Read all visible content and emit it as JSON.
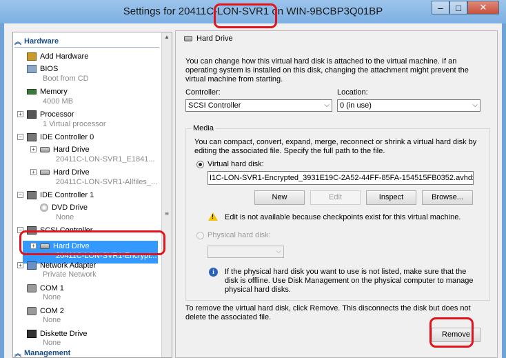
{
  "window": {
    "title": "Settings for 20411C-LON-SVR1 on WIN-9BCBP3Q01BP",
    "buttons": [
      "–",
      "□",
      "✕"
    ]
  },
  "sidebar": {
    "hardware_label": "Hardware",
    "management_label": "Management",
    "items": [
      {
        "label": "Add Hardware",
        "icon": "add-hardware-icon"
      },
      {
        "label": "BIOS",
        "sub": "Boot from CD",
        "icon": "bios-icon"
      },
      {
        "label": "Memory",
        "sub": "4000 MB",
        "icon": "memory-icon"
      },
      {
        "label": "Processor",
        "sub": "1 Virtual processor",
        "icon": "processor-icon"
      },
      {
        "label": "IDE Controller 0",
        "icon": "ide-controller-icon"
      },
      {
        "label": "Hard Drive",
        "sub": "20411C-LON-SVR1_E1841...",
        "icon": "hard-drive-icon"
      },
      {
        "label": "Hard Drive",
        "sub": "20411C-LON-SVR1-Allfiles_...",
        "icon": "hard-drive-icon"
      },
      {
        "label": "IDE Controller 1",
        "icon": "ide-controller-icon"
      },
      {
        "label": "DVD Drive",
        "sub": "None",
        "icon": "dvd-drive-icon"
      },
      {
        "label": "SCSI Controller",
        "icon": "scsi-controller-icon"
      },
      {
        "label": "Hard Drive",
        "sub": "20411C-LON-SVR1-Encrypt...",
        "icon": "hard-drive-icon"
      },
      {
        "label": "Network Adapter",
        "sub": "Private Network",
        "icon": "network-adapter-icon"
      },
      {
        "label": "COM 1",
        "sub": "None",
        "icon": "com-port-icon"
      },
      {
        "label": "COM 2",
        "sub": "None",
        "icon": "com-port-icon"
      },
      {
        "label": "Diskette Drive",
        "sub": "None",
        "icon": "diskette-drive-icon"
      }
    ]
  },
  "panel": {
    "title": "Hard Drive",
    "intro": "You can change how this virtual hard disk is attached to the virtual machine. If an operating system is installed on this disk, changing the attachment might prevent the virtual machine from starting.",
    "controller_label": "Controller:",
    "controller_value": "SCSI Controller",
    "location_label": "Location:",
    "location_value": "0 (in use)",
    "media_label": "Media",
    "media_desc": "You can compact, convert, expand, merge, reconnect or shrink a virtual hard disk by editing the associated file. Specify the full path to the file.",
    "vhd_label": "Virtual hard disk:",
    "vhd_path": "I1C-LON-SVR1-Encrypted_3931E19C-2A52-44FF-85FA-154515FB0352.avhdx",
    "btn_new": "New",
    "btn_edit": "Edit",
    "btn_inspect": "Inspect",
    "btn_browse": "Browse...",
    "warning": "Edit is not available because checkpoints exist for this virtual machine.",
    "phys_label": "Physical hard disk:",
    "phys_info": "If the physical hard disk you want to use is not listed, make sure that the disk is offline. Use Disk Management on the physical computer to manage physical hard disks.",
    "remove_desc": "To remove the virtual hard disk, click Remove. This disconnects the disk but does not delete the associated file.",
    "btn_remove": "Remove"
  }
}
